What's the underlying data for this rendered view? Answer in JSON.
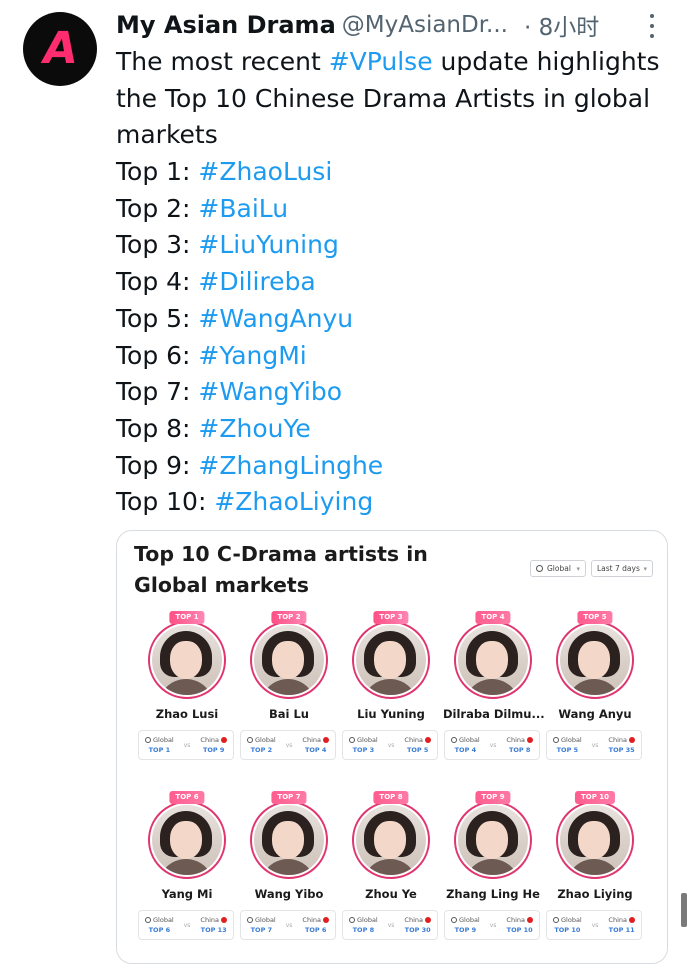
{
  "tweet": {
    "display_name": "My Asian Drama",
    "handle": "@MyAsianDr...",
    "time": "· 8小时",
    "avatar_logo": "ASIAN DRAMA",
    "text_lines": [
      [
        "The most recent ",
        "#VPulse",
        " update highlights"
      ],
      [
        "the Top 10 Chinese Drama Artists in global"
      ],
      [
        "markets"
      ]
    ],
    "ranks": [
      {
        "label": "Top 1: ",
        "tag": "#ZhaoLusi"
      },
      {
        "label": "Top 2: ",
        "tag": "#BaiLu"
      },
      {
        "label": "Top 3: ",
        "tag": "#LiuYuning"
      },
      {
        "label": "Top 4: ",
        "tag": "#Dilireba"
      },
      {
        "label": "Top 5: ",
        "tag": "#WangAnyu"
      },
      {
        "label": "Top 6: ",
        "tag": "#YangMi"
      },
      {
        "label": "Top 7: ",
        "tag": "#WangYibo"
      },
      {
        "label": "Top 8: ",
        "tag": "#ZhouYe"
      },
      {
        "label": "Top 9: ",
        "tag": "#ZhangLinghe"
      },
      {
        "label": "Top 10: ",
        "tag": "#ZhaoLiying"
      }
    ]
  },
  "card": {
    "title": "Top 10 C-Drama artists in Global markets",
    "filter_region": "Global",
    "filter_period": "Last 7 days",
    "global_label": "Global",
    "china_label": "China",
    "vs_label": "vs",
    "artists": [
      {
        "badge": "TOP 1",
        "name": "Zhao Lusi",
        "global_rank": "TOP 1",
        "china_rank": "TOP 9"
      },
      {
        "badge": "TOP 2",
        "name": "Bai Lu",
        "global_rank": "TOP 2",
        "china_rank": "TOP 4"
      },
      {
        "badge": "TOP 3",
        "name": "Liu Yuning",
        "global_rank": "TOP 3",
        "china_rank": "TOP 5"
      },
      {
        "badge": "TOP 4",
        "name": "Dilraba Dilmu...",
        "global_rank": "TOP 4",
        "china_rank": "TOP 8"
      },
      {
        "badge": "TOP 5",
        "name": "Wang Anyu",
        "global_rank": "TOP 5",
        "china_rank": "TOP 35"
      },
      {
        "badge": "TOP 6",
        "name": "Yang Mi",
        "global_rank": "TOP 6",
        "china_rank": "TOP 13"
      },
      {
        "badge": "TOP 7",
        "name": "Wang Yibo",
        "global_rank": "TOP 7",
        "china_rank": "TOP 6"
      },
      {
        "badge": "TOP 8",
        "name": "Zhou Ye",
        "global_rank": "TOP 8",
        "china_rank": "TOP 30"
      },
      {
        "badge": "TOP 9",
        "name": "Zhang Ling He",
        "global_rank": "TOP 9",
        "china_rank": "TOP 10"
      },
      {
        "badge": "TOP 10",
        "name": "Zhao Liying",
        "global_rank": "TOP 10",
        "china_rank": "TOP 11"
      }
    ]
  },
  "colors": {
    "hashtag": "#1d9bf0",
    "badge": "#ff5d8f",
    "ring": "#e0356f",
    "rank": "#3a7bd5"
  }
}
